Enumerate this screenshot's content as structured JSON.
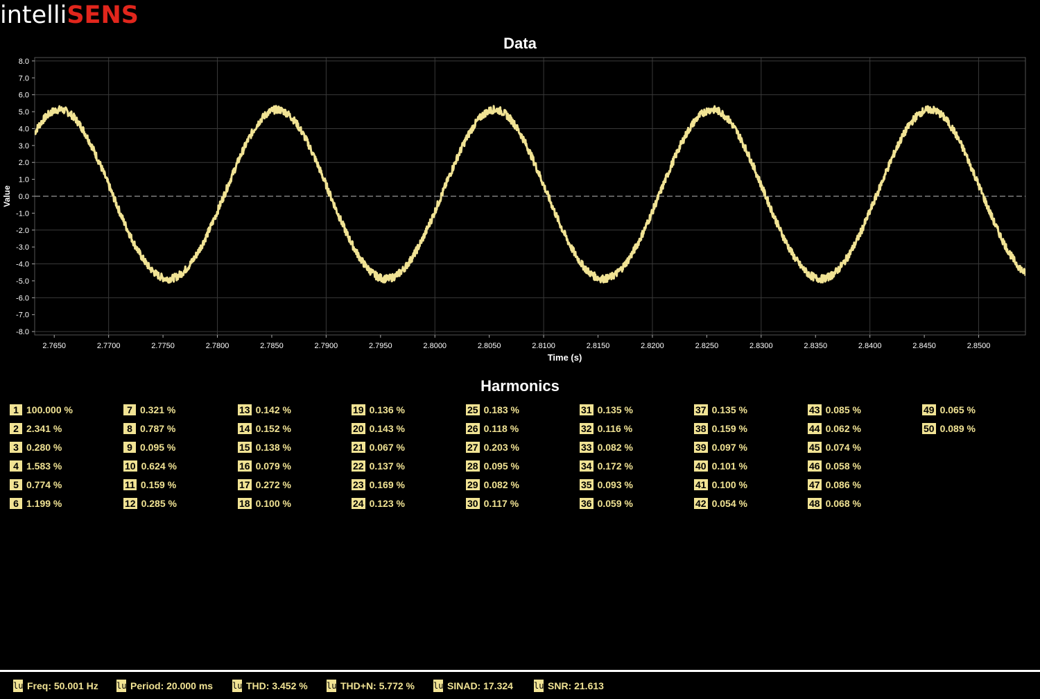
{
  "brand": {
    "part1": "intelli",
    "part2": "SENS"
  },
  "chart_data": {
    "type": "line",
    "title": "Data",
    "xlabel": "Time (s)",
    "ylabel": "Value",
    "xlim": [
      2.7632,
      2.8543
    ],
    "ylim": [
      -8.2,
      8.2
    ],
    "xticks": [
      2.765,
      2.77,
      2.775,
      2.78,
      2.785,
      2.79,
      2.795,
      2.8,
      2.805,
      2.81,
      2.815,
      2.82,
      2.825,
      2.83,
      2.835,
      2.84,
      2.845,
      2.85
    ],
    "xtick_labels": [
      "2.7650",
      "2.7700",
      "2.7750",
      "2.7800",
      "2.7850",
      "2.7900",
      "2.7950",
      "2.8000",
      "2.8050",
      "2.8100",
      "2.8150",
      "2.8200",
      "2.8250",
      "2.8300",
      "2.8350",
      "2.8400",
      "2.8450",
      "2.8500"
    ],
    "yticks": [
      8,
      7,
      6,
      5,
      4,
      3,
      2,
      1,
      0,
      -1,
      -2,
      -3,
      -4,
      -5,
      -6,
      -7,
      -8
    ],
    "ytick_labels": [
      "8.0",
      "7.0",
      "6.0",
      "5.0",
      "4.0",
      "3.0",
      "2.0",
      "1.0",
      "0.0",
      "-1.0",
      "-2.0",
      "-3.0",
      "-4.0",
      "-5.0",
      "-6.0",
      "-7.0",
      "-8.0"
    ],
    "grid": true,
    "zero_line": "dashed",
    "series": [
      {
        "frequency_hz": 50.001,
        "amplitude": 5.0,
        "peak_time": 2.7655,
        "color": "#f1e394"
      }
    ]
  },
  "harmonics": {
    "title": "Harmonics",
    "items": [
      {
        "n": "1",
        "v": "100.000 %"
      },
      {
        "n": "2",
        "v": "2.341 %"
      },
      {
        "n": "3",
        "v": "0.280 %"
      },
      {
        "n": "4",
        "v": "1.583 %"
      },
      {
        "n": "5",
        "v": "0.774 %"
      },
      {
        "n": "6",
        "v": "1.199 %"
      },
      {
        "n": "7",
        "v": "0.321 %"
      },
      {
        "n": "8",
        "v": "0.787 %"
      },
      {
        "n": "9",
        "v": "0.095 %"
      },
      {
        "n": "10",
        "v": "0.624 %"
      },
      {
        "n": "11",
        "v": "0.159 %"
      },
      {
        "n": "12",
        "v": "0.285 %"
      },
      {
        "n": "13",
        "v": "0.142 %"
      },
      {
        "n": "14",
        "v": "0.152 %"
      },
      {
        "n": "15",
        "v": "0.138 %"
      },
      {
        "n": "16",
        "v": "0.079 %"
      },
      {
        "n": "17",
        "v": "0.272 %"
      },
      {
        "n": "18",
        "v": "0.100 %"
      },
      {
        "n": "19",
        "v": "0.136 %"
      },
      {
        "n": "20",
        "v": "0.143 %"
      },
      {
        "n": "21",
        "v": "0.067 %"
      },
      {
        "n": "22",
        "v": "0.137 %"
      },
      {
        "n": "23",
        "v": "0.169 %"
      },
      {
        "n": "24",
        "v": "0.123 %"
      },
      {
        "n": "25",
        "v": "0.183 %"
      },
      {
        "n": "26",
        "v": "0.118 %"
      },
      {
        "n": "27",
        "v": "0.203 %"
      },
      {
        "n": "28",
        "v": "0.095 %"
      },
      {
        "n": "29",
        "v": "0.082 %"
      },
      {
        "n": "30",
        "v": "0.117 %"
      },
      {
        "n": "31",
        "v": "0.135 %"
      },
      {
        "n": "32",
        "v": "0.116 %"
      },
      {
        "n": "33",
        "v": "0.082 %"
      },
      {
        "n": "34",
        "v": "0.172 %"
      },
      {
        "n": "35",
        "v": "0.093 %"
      },
      {
        "n": "36",
        "v": "0.059 %"
      },
      {
        "n": "37",
        "v": "0.135 %"
      },
      {
        "n": "38",
        "v": "0.159 %"
      },
      {
        "n": "39",
        "v": "0.097 %"
      },
      {
        "n": "40",
        "v": "0.101 %"
      },
      {
        "n": "41",
        "v": "0.100 %"
      },
      {
        "n": "42",
        "v": "0.054 %"
      },
      {
        "n": "43",
        "v": "0.085 %"
      },
      {
        "n": "44",
        "v": "0.062 %"
      },
      {
        "n": "45",
        "v": "0.074 %"
      },
      {
        "n": "46",
        "v": "0.058 %"
      },
      {
        "n": "47",
        "v": "0.086 %"
      },
      {
        "n": "48",
        "v": "0.068 %"
      },
      {
        "n": "49",
        "v": "0.065 %"
      },
      {
        "n": "50",
        "v": "0.089 %"
      }
    ]
  },
  "stats": [
    {
      "icon": "lu",
      "label": "Freq: 50.001 Hz"
    },
    {
      "icon": "lu",
      "label": "Period: 20.000 ms"
    },
    {
      "icon": "lu",
      "label": "THD: 3.452 %"
    },
    {
      "icon": "lu",
      "label": "THD+N: 5.772 %"
    },
    {
      "icon": "lu",
      "label": "SINAD: 17.324"
    },
    {
      "icon": "lu",
      "label": "SNR: 21.613"
    }
  ],
  "colors": {
    "trace": "#f1e394",
    "brand_red": "#e1261c",
    "grid": "#3a3a3a"
  }
}
